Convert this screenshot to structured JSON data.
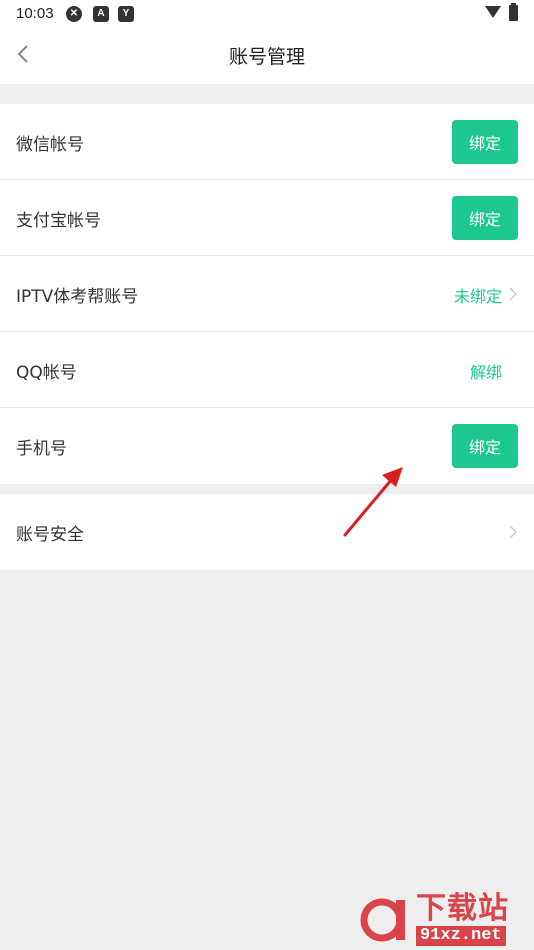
{
  "status_bar": {
    "time": "10:03",
    "icons": [
      "app-icon",
      "a-icon",
      "y-icon"
    ],
    "icon_letters": [
      "✕",
      "A",
      "Y"
    ]
  },
  "header": {
    "back_icon": "chevron-left-icon",
    "title": "账号管理"
  },
  "accounts": {
    "wechat": {
      "label": "微信帐号",
      "action": "绑定"
    },
    "alipay": {
      "label": "支付宝帐号",
      "action": "绑定"
    },
    "iptv": {
      "label": "IPTV体考帮账号",
      "status": "未绑定"
    },
    "qq": {
      "label": "QQ帐号",
      "action": "解绑"
    },
    "phone": {
      "label": "手机号",
      "action": "绑定"
    }
  },
  "security": {
    "label": "账号安全"
  },
  "watermark": {
    "logo": "91-logo",
    "text": "下载站",
    "url": "91xz.net"
  },
  "colors": {
    "accent": "#1dc890",
    "background": "#eeeeee",
    "watermark": "#d9434a"
  }
}
